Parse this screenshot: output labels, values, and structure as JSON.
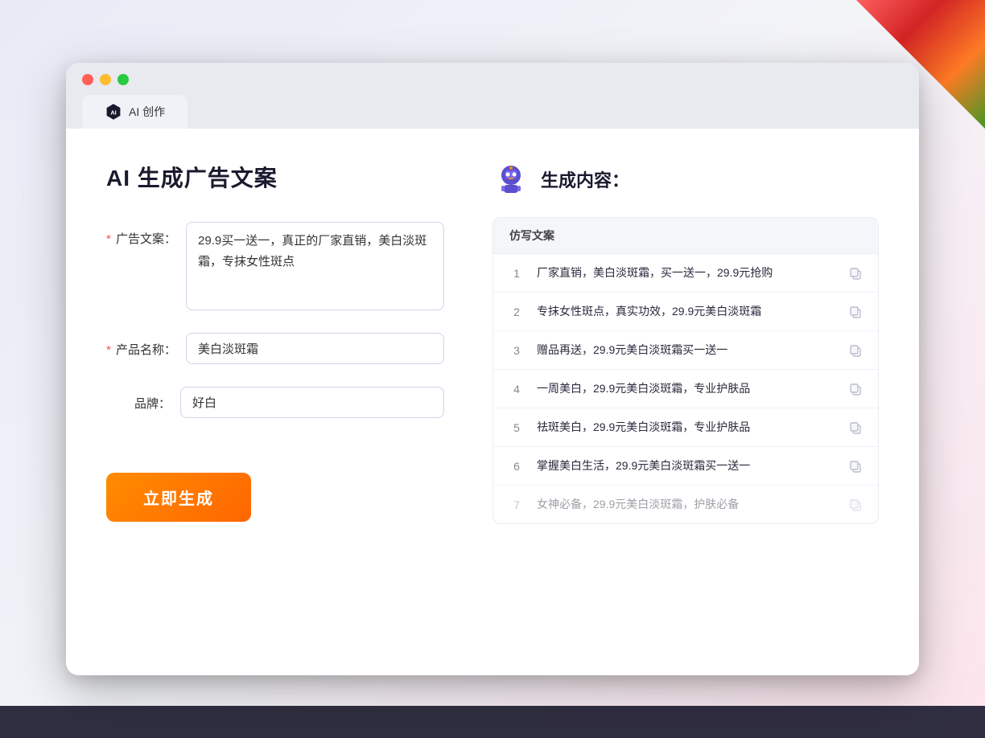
{
  "window": {
    "tab_label": "AI 创作"
  },
  "page": {
    "title": "AI 生成广告文案"
  },
  "form": {
    "ad_copy_label": "广告文案：",
    "ad_copy_required": true,
    "ad_copy_value": "29.9买一送一，真正的厂家直销，美白淡斑霜，专抹女性斑点",
    "product_name_label": "产品名称：",
    "product_name_required": true,
    "product_name_value": "美白淡斑霜",
    "brand_label": "品牌：",
    "brand_required": false,
    "brand_value": "好白",
    "generate_btn_label": "立即生成"
  },
  "result": {
    "header_label": "生成内容：",
    "table_header": "仿写文案",
    "rows": [
      {
        "number": "1",
        "text": "厂家直销，美白淡斑霜，买一送一，29.9元抢购",
        "faded": false
      },
      {
        "number": "2",
        "text": "专抹女性斑点，真实功效，29.9元美白淡斑霜",
        "faded": false
      },
      {
        "number": "3",
        "text": "赠品再送，29.9元美白淡斑霜买一送一",
        "faded": false
      },
      {
        "number": "4",
        "text": "一周美白，29.9元美白淡斑霜，专业护肤品",
        "faded": false
      },
      {
        "number": "5",
        "text": "祛斑美白，29.9元美白淡斑霜，专业护肤品",
        "faded": false
      },
      {
        "number": "6",
        "text": "掌握美白生活，29.9元美白淡斑霜买一送一",
        "faded": false
      },
      {
        "number": "7",
        "text": "女神必备，29.9元美白淡斑霜，护肤必备",
        "faded": true
      }
    ]
  }
}
